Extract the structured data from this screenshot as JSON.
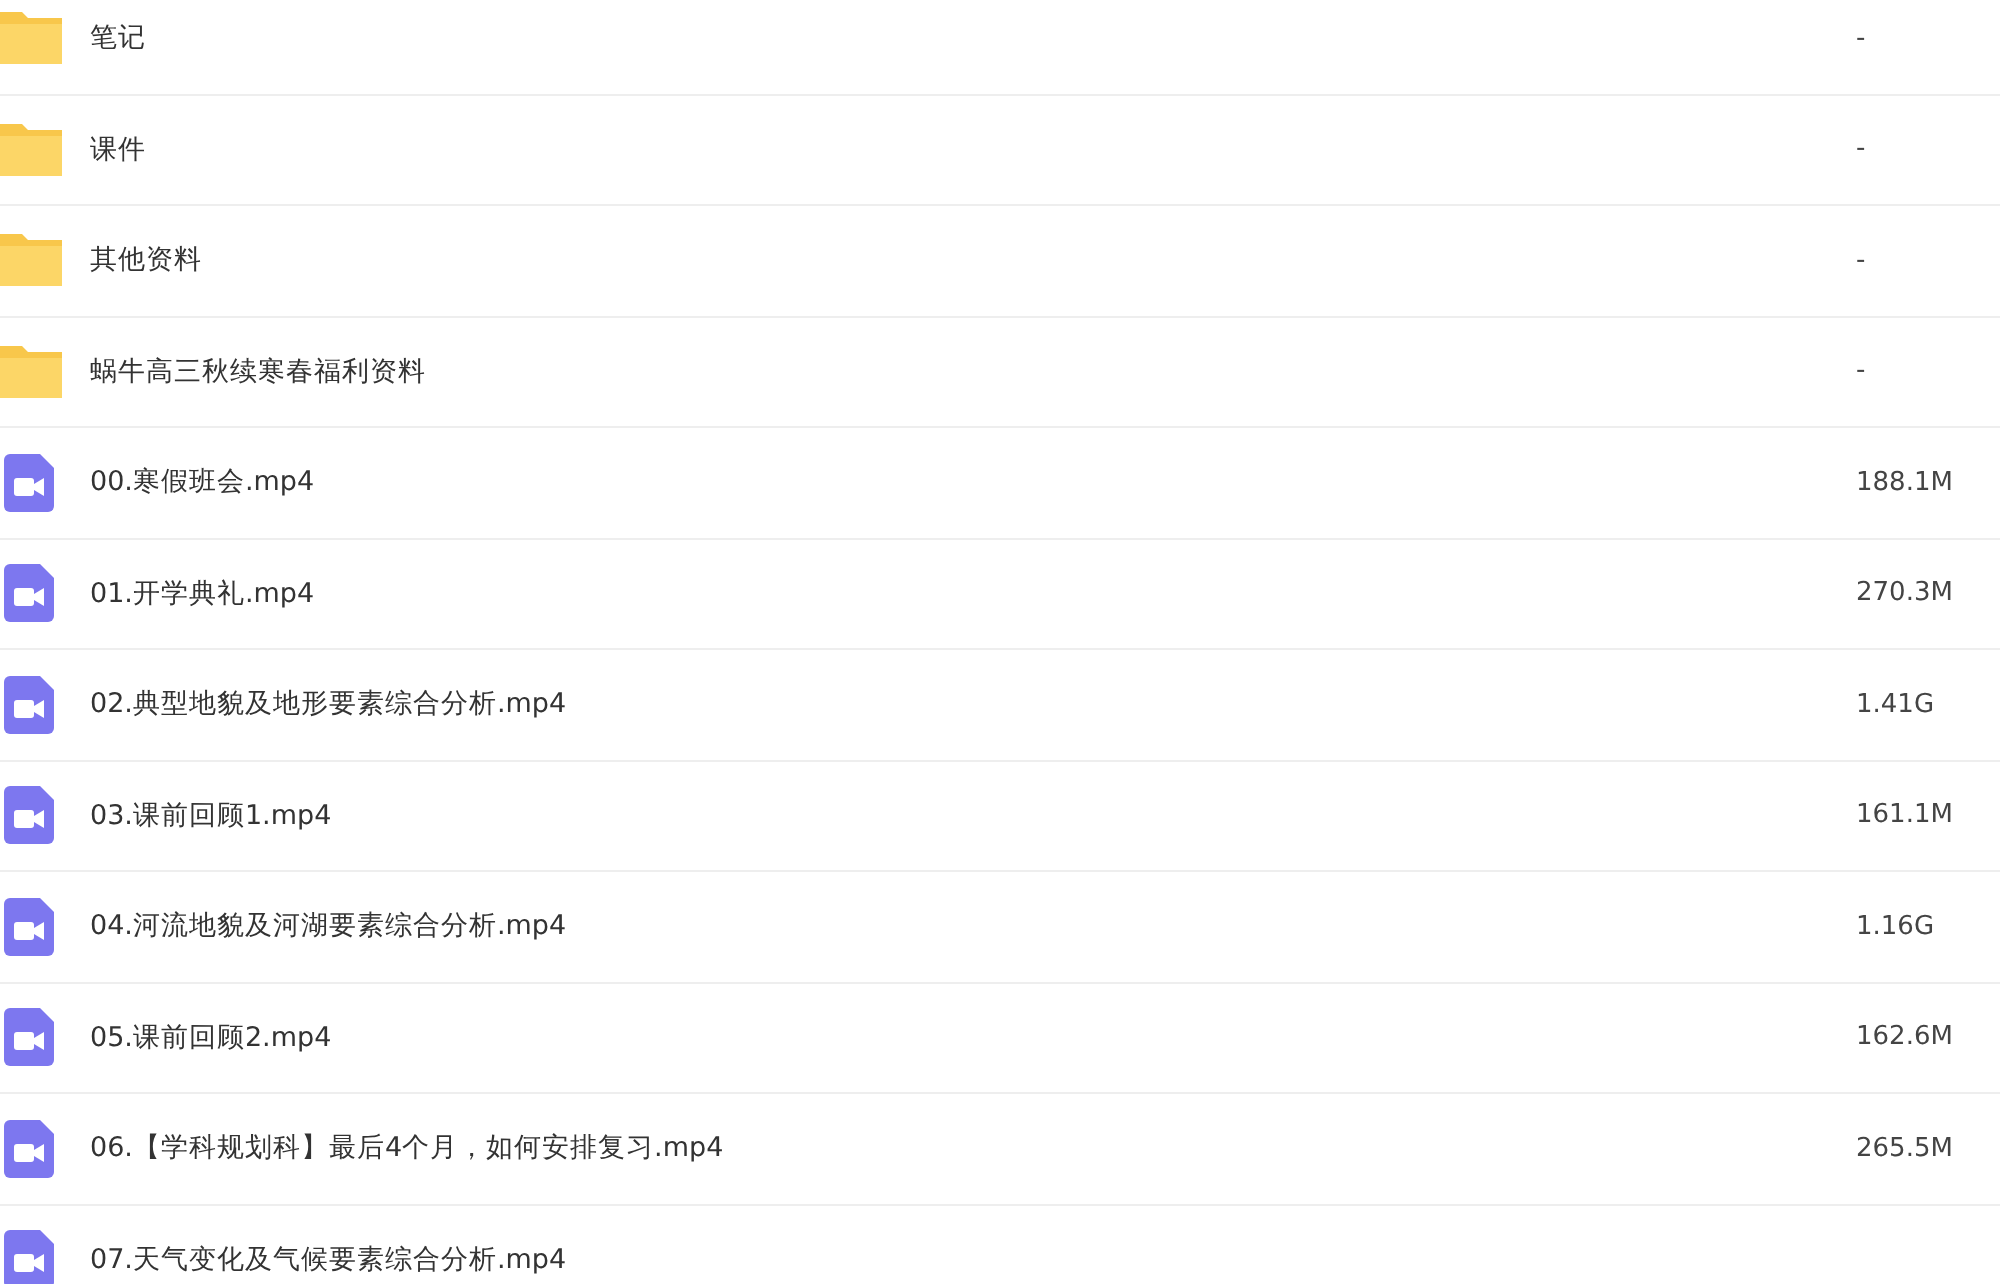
{
  "files": [
    {
      "kind": "folder",
      "name": "笔记",
      "size": "-"
    },
    {
      "kind": "folder",
      "name": "课件",
      "size": "-"
    },
    {
      "kind": "folder",
      "name": "其他资料",
      "size": "-"
    },
    {
      "kind": "folder",
      "name": "蜗牛高三秋续寒春福利资料",
      "size": "-"
    },
    {
      "kind": "video",
      "name": "00.寒假班会.mp4",
      "size": "188.1M"
    },
    {
      "kind": "video",
      "name": "01.开学典礼.mp4",
      "size": "270.3M"
    },
    {
      "kind": "video",
      "name": "02.典型地貌及地形要素综合分析.mp4",
      "size": "1.41G"
    },
    {
      "kind": "video",
      "name": "03.课前回顾1.mp4",
      "size": "161.1M"
    },
    {
      "kind": "video",
      "name": "04.河流地貌及河湖要素综合分析.mp4",
      "size": "1.16G"
    },
    {
      "kind": "video",
      "name": "05.课前回顾2.mp4",
      "size": "162.6M"
    },
    {
      "kind": "video",
      "name": "06.【学科规划科】最后4个月，如何安排复习.mp4",
      "size": "265.5M"
    },
    {
      "kind": "video",
      "name": "07.天气变化及气候要素综合分析.mp4"
    }
  ]
}
